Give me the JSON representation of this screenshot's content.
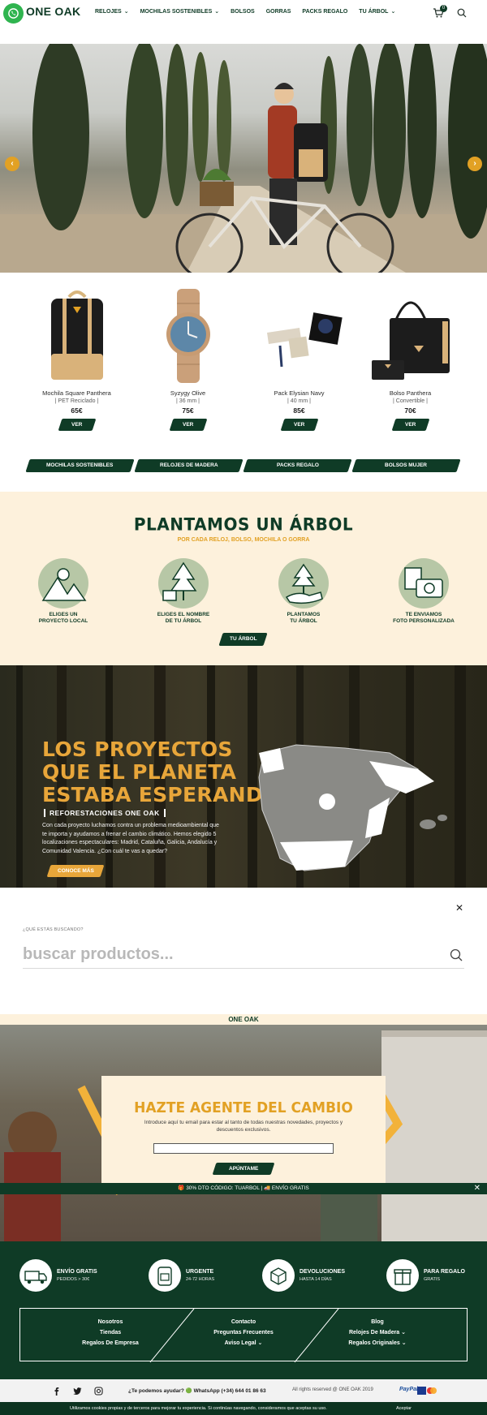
{
  "header": {
    "logo": "ONE OAK",
    "nav": [
      {
        "label": "RELOJES",
        "dropdown": true
      },
      {
        "label": "MOCHILAS SOSTENIBLES",
        "dropdown": true
      },
      {
        "label": "BOLSOS",
        "dropdown": false
      },
      {
        "label": "GORRAS",
        "dropdown": false
      },
      {
        "label": "PACKS REGALO",
        "dropdown": false
      },
      {
        "label": "TU ÁRBOL",
        "dropdown": true
      }
    ],
    "cart_count": "0"
  },
  "products": [
    {
      "name": "Mochila Square Panthera",
      "sub": "| PET Reciclado |",
      "price": "65€",
      "button": "VER"
    },
    {
      "name": "Syzygy Olive",
      "sub": "| 36 mm |",
      "price": "75€",
      "button": "VER"
    },
    {
      "name": "Pack Elysian Navy",
      "sub": "| 40 mm |",
      "price": "85€",
      "button": "VER"
    },
    {
      "name": "Bolso Panthera",
      "sub": "| Convertible |",
      "price": "70€",
      "button": "VER"
    }
  ],
  "categories": [
    "MOCHILAS SOSTENIBLES",
    "RELOJES DE MADERA",
    "PACKS REGALO",
    "BOLSOS MUJER"
  ],
  "tree": {
    "title": "PLANTAMOS UN ÁRBOL",
    "subtitle": "POR CADA RELOJ, BOLSO, MOCHILA O GORRA",
    "steps": [
      {
        "text": "ELIGES UN\nPROYECTO LOCAL",
        "icon": "mountain-icon"
      },
      {
        "text": "ELIGES EL NOMBRE\nDE TU ÁRBOL",
        "icon": "tree-sign-icon"
      },
      {
        "text": "PLANTAMOS\nTU ÁRBOL",
        "icon": "hand-plant-icon"
      },
      {
        "text": "TE ENVIAMOS\nFOTO PERSONALIZADA",
        "icon": "camera-photo-icon"
      }
    ],
    "button": "TU ÁRBOL"
  },
  "projects": {
    "title_lines": [
      "LOS PROYECTOS",
      "QUE EL PLANETA",
      "ESTABA ESPERANDO"
    ],
    "subtitle": "REFORESTACIONES ONE OAK",
    "text": "Con cada proyecto luchamos contra un problema medioambiental que te importa y ayudamos a frenar el cambio climático. Hemos elegido 5 localizaciones espectaculares: Madrid, Cataluña, Galicia, Andalucía y Comunidad Valencia. ¿Con cuál te vas a quedar?",
    "button": "CONOCE MÁS"
  },
  "search": {
    "label": "¿QUÉ ESTÁS BUSCANDO?",
    "placeholder": "buscar productos..."
  },
  "newsletter": {
    "strip": "ONE OAK",
    "title": "HAZTE AGENTE DEL CAMBIO",
    "text": "Introduce aquí tu email para estar al tanto de todas nuestras novedades, proyectos y descuentos exclusivos.",
    "button": "APÚNTAME"
  },
  "promo": "🎁 30% DTO CÓDIGO: TUARBOL | 🚚 ENVÍO GRATIS",
  "perks": [
    {
      "title": "ENVÍO GRATIS",
      "sub": "PEDIDOS > 30€",
      "icon": "truck-icon"
    },
    {
      "title": "URGENTE",
      "sub": "24-72 HORAS",
      "icon": "backpack-icon"
    },
    {
      "title": "DEVOLUCIONES",
      "sub": "HASTA 14 DÍAS",
      "icon": "return-box-icon"
    },
    {
      "title": "PARA REGALO",
      "sub": "GRATIS",
      "icon": "gift-icon"
    }
  ],
  "footer_links": {
    "col1": [
      "Nosotros",
      "Tiendas",
      "Regalos De Empresa"
    ],
    "col2": [
      "Contacto",
      "Preguntas Frecuentes",
      "Aviso Legal"
    ],
    "col3": [
      "Blog",
      "Relojes De Madera",
      "Regalos Originales"
    ]
  },
  "bottom": {
    "help": "¿Te podemos ayudar? 🟢 WhatsApp (+34) 644 01 86 63",
    "rights": "All rights reserved @ ONE OAK 2019",
    "payment": "PayPal"
  },
  "cookie": {
    "text": "Utilizamos cookies propias y de terceros para mejorar tu experiencia. Si continúas navegando, consideramos que aceptas su uso.",
    "accept": "Aceptar"
  },
  "colors": {
    "brand_green": "#0f3b26",
    "accent_orange": "#e2a124",
    "cream": "#fdf1dc"
  }
}
